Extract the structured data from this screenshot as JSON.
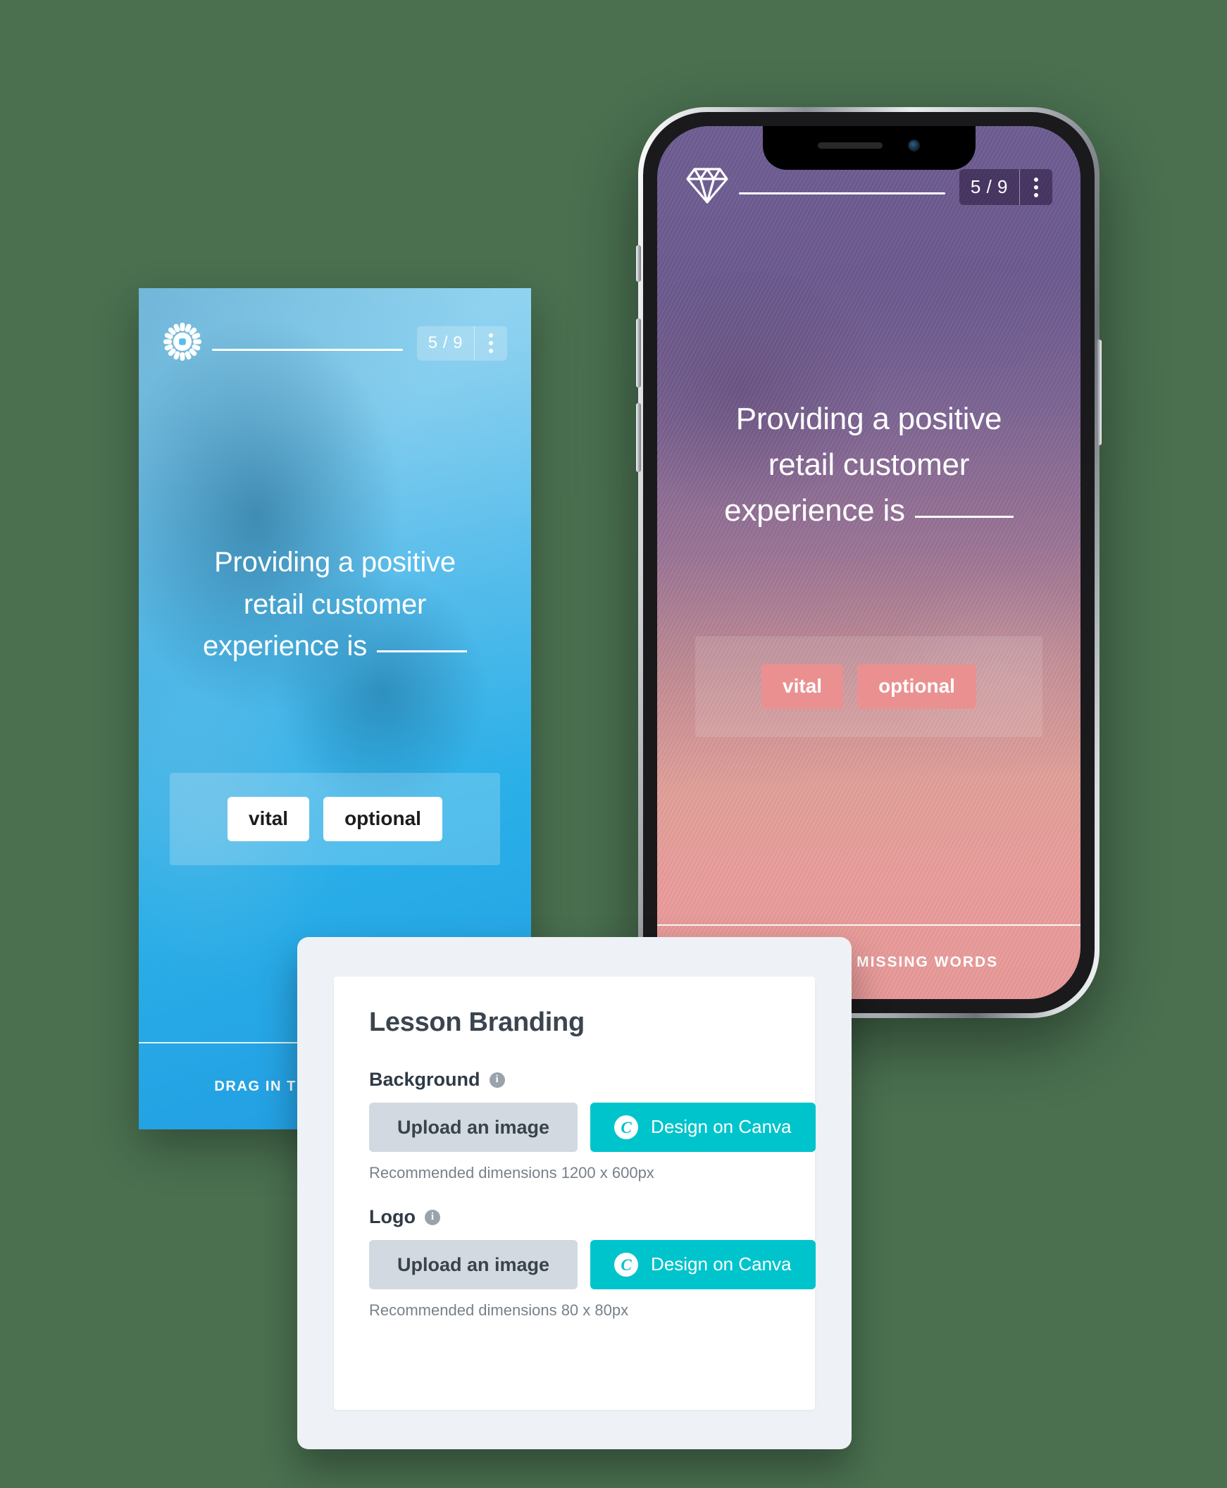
{
  "theme": {
    "page_background": "#4a7050",
    "canva_teal": "#00c4cc",
    "upload_grey": "#d2d9e0",
    "salmon_chip": "#eb9090",
    "blue_screen": "#29ace4"
  },
  "blue_phone": {
    "logo_icon": "flower-gear-logo-icon",
    "counter": "5 / 9",
    "menu_icon": "kebab-menu-icon",
    "question": {
      "line1": "Providing a positive",
      "line2": "retail customer",
      "line3": "experience is"
    },
    "answers": [
      {
        "label": "vital"
      },
      {
        "label": "optional"
      }
    ],
    "footer_instruction": "DRAG IN THE MISSING WORDS"
  },
  "iphone": {
    "logo_icon": "diamond-logo-icon",
    "counter": "5 / 9",
    "menu_icon": "kebab-menu-icon",
    "question": {
      "line1": "Providing a positive",
      "line2": "retail customer",
      "line3": "experience is"
    },
    "answers": [
      {
        "label": "vital"
      },
      {
        "label": "optional"
      }
    ],
    "footer_instruction": "DRAG IN THE MISSING WORDS"
  },
  "branding_card": {
    "title": "Lesson Branding",
    "fields": [
      {
        "label": "Background",
        "info_icon": "info-icon",
        "upload_label": "Upload an image",
        "canva_label": "Design on Canva",
        "canva_icon": "canva-c-icon",
        "hint": "Recommended dimensions 1200 x 600px"
      },
      {
        "label": "Logo",
        "info_icon": "info-icon",
        "upload_label": "Upload an image",
        "canva_label": "Design on Canva",
        "canva_icon": "canva-c-icon",
        "hint": "Recommended dimensions 80 x 80px"
      }
    ]
  }
}
